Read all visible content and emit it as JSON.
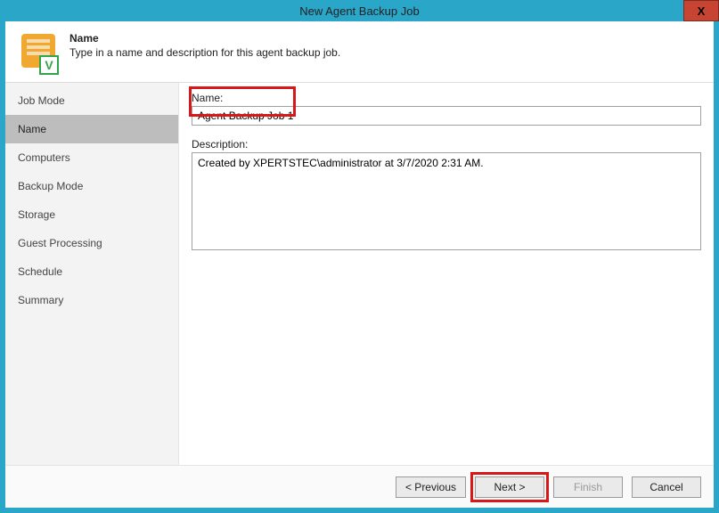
{
  "window": {
    "title": "New Agent Backup Job",
    "close_glyph": "X"
  },
  "header": {
    "title": "Name",
    "subtitle": "Type in a name and description for this agent backup job.",
    "badge_letter": "V"
  },
  "sidebar": {
    "items": [
      {
        "label": "Job Mode",
        "active": false
      },
      {
        "label": "Name",
        "active": true
      },
      {
        "label": "Computers",
        "active": false
      },
      {
        "label": "Backup Mode",
        "active": false
      },
      {
        "label": "Storage",
        "active": false
      },
      {
        "label": "Guest Processing",
        "active": false
      },
      {
        "label": "Schedule",
        "active": false
      },
      {
        "label": "Summary",
        "active": false
      }
    ]
  },
  "form": {
    "name_label": "Name:",
    "name_value": "Agent Backup Job 1",
    "description_label": "Description:",
    "description_value": "Created by XPERTSTEC\\administrator at 3/7/2020 2:31 AM."
  },
  "footer": {
    "previous": "< Previous",
    "next": "Next >",
    "finish": "Finish",
    "cancel": "Cancel"
  }
}
